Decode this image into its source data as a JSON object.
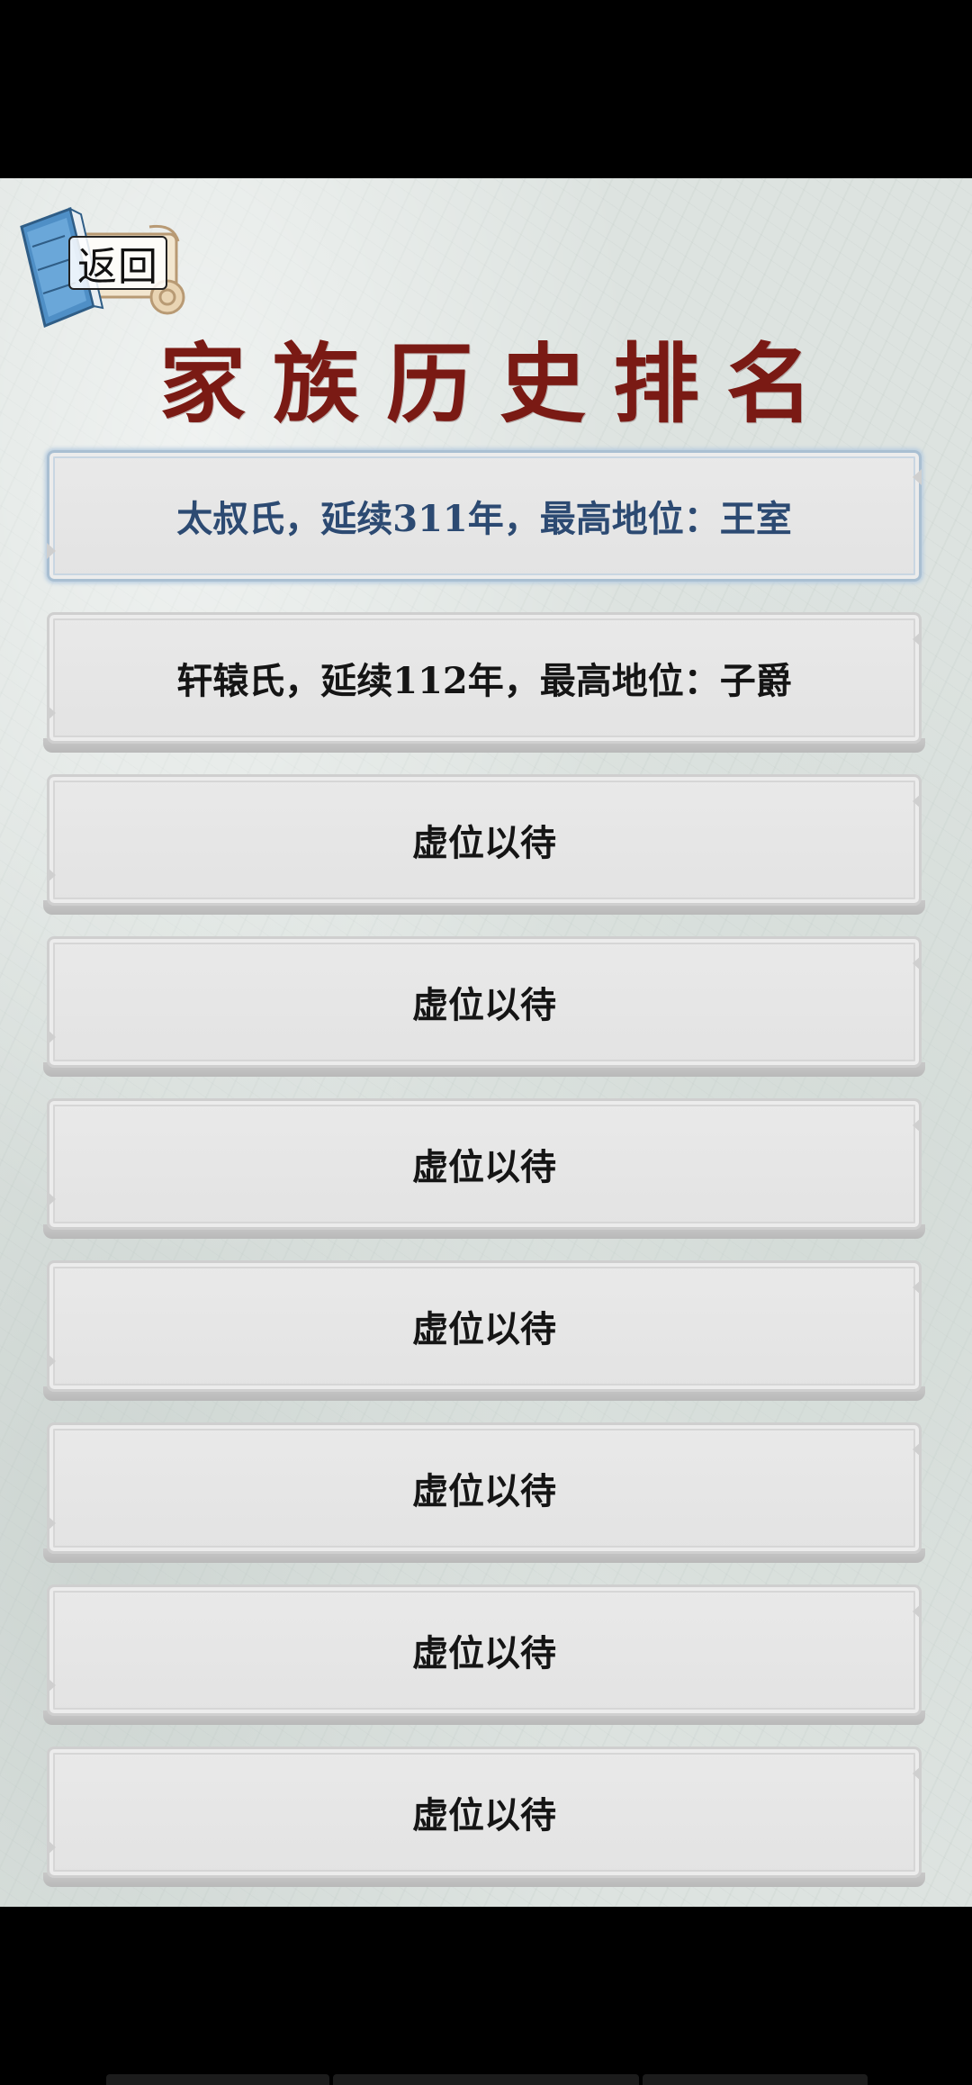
{
  "back_button": {
    "label": "返回"
  },
  "title": "家族历史排名",
  "rows": [
    {
      "text": "太叔氏，延续311年，最高地位：王室",
      "selected": true
    },
    {
      "text": "轩辕氏，延续112年，最高地位：子爵",
      "selected": false
    },
    {
      "text": "虚位以待",
      "selected": false
    },
    {
      "text": "虚位以待",
      "selected": false
    },
    {
      "text": "虚位以待",
      "selected": false
    },
    {
      "text": "虚位以待",
      "selected": false
    },
    {
      "text": "虚位以待",
      "selected": false
    },
    {
      "text": "虚位以待",
      "selected": false
    },
    {
      "text": "虚位以待",
      "selected": false
    }
  ],
  "colors": {
    "title": "#7a1a14",
    "selected_text": "#2c4a72",
    "row_text": "#151515",
    "paper": "#dde3e0"
  }
}
